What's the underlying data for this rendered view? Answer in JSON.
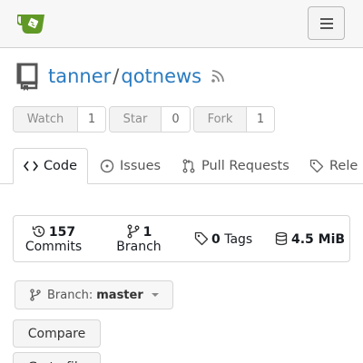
{
  "brand": {
    "logo_icon": "gitea-teacup-logo",
    "brand_color": "#609926"
  },
  "navbar": {
    "menu_icon": "hamburger-icon"
  },
  "repo": {
    "owner": "tanner",
    "separator": "/",
    "name": "qotnews",
    "link_color": "#2a7bc0"
  },
  "actions": {
    "watch": {
      "label": "Watch",
      "count": "1"
    },
    "star": {
      "label": "Star",
      "count": "0"
    },
    "fork": {
      "label": "Fork",
      "count": "1"
    }
  },
  "tabs": [
    {
      "label": "Code",
      "icon": "code-icon",
      "active": true
    },
    {
      "label": "Issues",
      "icon": "issue-opened-icon",
      "active": false
    },
    {
      "label": "Pull Requests",
      "icon": "git-pull-request-icon",
      "active": false
    },
    {
      "label": "Rele",
      "icon": "tag-icon",
      "active": false
    }
  ],
  "stats": {
    "commits": {
      "count": "157",
      "label": "Commits"
    },
    "branch": {
      "count": "1",
      "label": "Branch"
    },
    "tags": {
      "count": "0",
      "label": "Tags"
    },
    "size": {
      "value": "4.5 MiB"
    }
  },
  "branch_selector": {
    "prefix": "Branch:",
    "value": "master"
  },
  "buttons": {
    "compare": "Compare",
    "go_to_file": "Go to file"
  }
}
